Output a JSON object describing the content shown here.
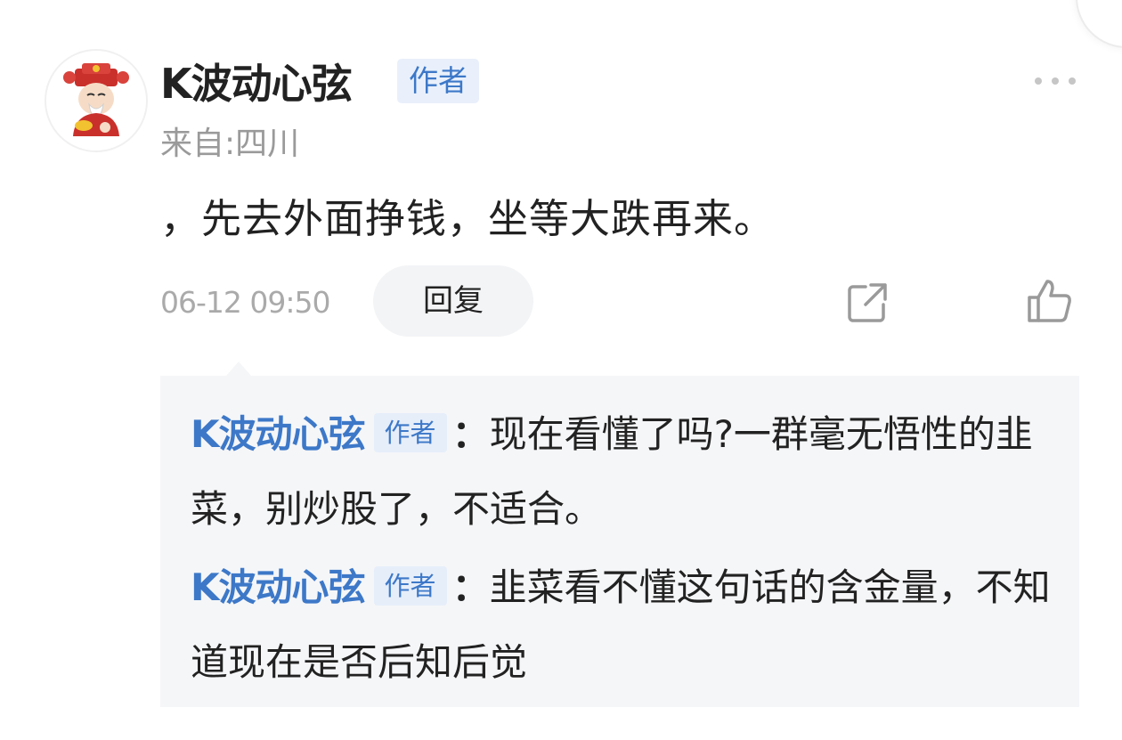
{
  "comment": {
    "username": "K波动心弦",
    "author_tag": "作者",
    "location": "来自:四川",
    "text": "，先去外面挣钱，坐等大跌再来。",
    "timestamp": "06-12 09:50",
    "reply_label": "回复"
  },
  "replies": [
    {
      "username": "K波动心弦",
      "author_tag": "作者",
      "separator": "：",
      "text": "现在看懂了吗?一群毫无悟性的韭菜，别炒股了，不适合。"
    },
    {
      "username": "K波动心弦",
      "author_tag": "作者",
      "separator": "：",
      "text": "韭菜看不懂这句话的含金量，不知道现在是否后知后觉"
    }
  ],
  "icons": {
    "more": "more-dots-icon",
    "share": "share-icon",
    "like": "thumbs-up-icon"
  },
  "colors": {
    "accent": "#3d78c8",
    "tag_background": "#e9f0fb",
    "muted_text": "#9a9a9a",
    "reply_box_background": "#f5f6f8"
  }
}
